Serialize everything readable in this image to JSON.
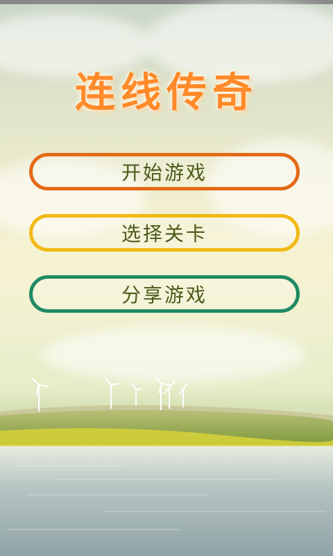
{
  "app": {
    "title": "连线传奇"
  },
  "menu": {
    "start_label": "开始游戏",
    "select_level_label": "选择关卡",
    "share_label": "分享游戏"
  },
  "colors": {
    "title": "#ff8a2a",
    "start_border": "#e36a17",
    "select_level_border": "#f2b915",
    "share_border": "#1f8a63",
    "button_text": "#4a5a1a"
  }
}
